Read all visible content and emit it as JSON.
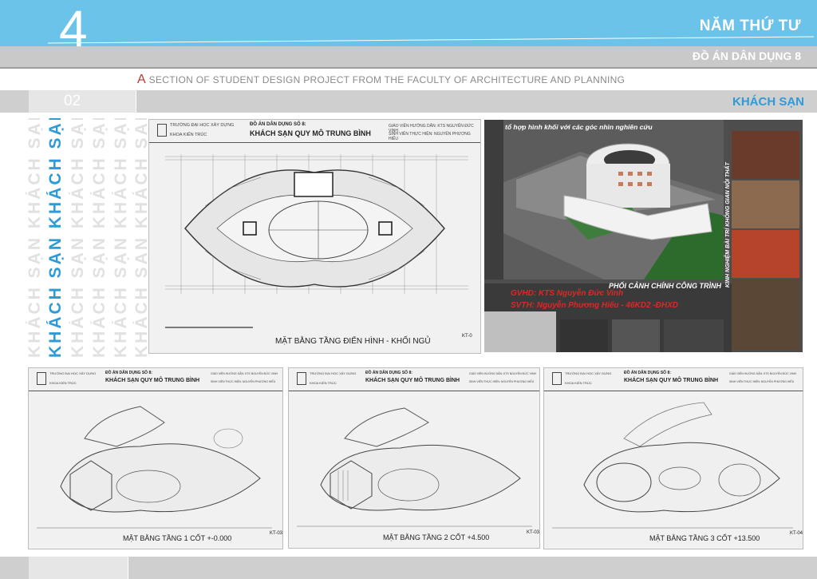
{
  "header": {
    "number": "4",
    "title": "NĂM THỨ TƯ",
    "subtitle": "ĐỒ ÁN DÂN DỤNG 8",
    "section_first_letter": "A",
    "section_rest": " SECTION OF STUDENT DESIGN PROJECT FROM THE FACULTY OF ARCHITECTURE AND PLANNING"
  },
  "band": {
    "page_number": "02",
    "section_name": "KHÁCH SẠN"
  },
  "side_text": "KHÁCH SẠN KHÁCH SẠN",
  "colors": {
    "header_blue": "#6cc3ea",
    "accent": "#2e9bd8",
    "band_grey": "#cfcfcf",
    "highlight_red": "#c0392b"
  },
  "main_sheet": {
    "school": "TRƯỜNG ĐẠI HỌC XÂY DỰNG",
    "department": "KHOA KIẾN TRÚC",
    "project": "ĐỒ ÁN DÂN DỤNG SỐ 8:",
    "name": "KHÁCH SẠN QUY MÔ TRUNG BÌNH",
    "tutor": "GIÁO VIÊN HƯỚNG DẪN: KTS NGUYỄN ĐỨC VINH",
    "student": "SINH VIÊN THỰC HIỆN: NGUYỄN PHƯƠNG HIẾU",
    "caption": "MẶT BẰNG TẦNG ĐIỂN HÌNH - KHỐI NGỦ",
    "code": "KT-0"
  },
  "render": {
    "title": "tổ hợp hình khối với các góc nhìn nghiên cứu",
    "perspective": "PHỐI CẢNH CHÍNH CÔNG TRÌNH",
    "gvhd": "GVHD: KTS Nguyễn Đức Vinh",
    "svth": "SVTH: Nguyễn Phương Hiếu - 46KD2 -ĐHXD",
    "side_label": "KINH NGHIỆM BÀI TRÍ KHÔNG GIAN NỘI THẤT"
  },
  "sheets": [
    {
      "school": "TRƯỜNG ĐẠI HỌC XÂY DỰNG",
      "department": "KHOA KIẾN TRÚC",
      "project": "ĐỒ ÁN DÂN DỤNG SỐ 8:",
      "name": "KHÁCH SẠN QUY MÔ TRUNG BÌNH",
      "tutor": "GIÁO VIÊN HƯỚNG DẪN: KTS NGUYỄN ĐỨC VINH",
      "student": "SINH VIÊN THỰC HIỆN: NGUYỄN PHƯƠNG HIẾU",
      "caption": "MẶT BẰNG TẦNG 1 CỐT +-0.000",
      "code": "KT-03"
    },
    {
      "school": "TRƯỜNG ĐẠI HỌC XÂY DỰNG",
      "department": "KHOA KIẾN TRÚC",
      "project": "ĐỒ ÁN DÂN DỤNG SỐ 8:",
      "name": "KHÁCH SẠN QUY MÔ TRUNG BÌNH",
      "tutor": "GIÁO VIÊN HƯỚNG DẪN: KTS NGUYỄN ĐỨC VINH",
      "student": "SINH VIÊN THỰC HIỆN: NGUYỄN PHƯƠNG HIẾU",
      "caption": "MẶT BẰNG TẦNG 2 CỐT +4.500",
      "code": "KT-03"
    },
    {
      "school": "TRƯỜNG ĐẠI HỌC XÂY DỰNG",
      "department": "KHOA KIẾN TRÚC",
      "project": "ĐỒ ÁN DÂN DỤNG SỐ 8:",
      "name": "KHÁCH SẠN QUY MÔ TRUNG BÌNH",
      "tutor": "GIÁO VIÊN HƯỚNG DẪN: KTS NGUYỄN ĐỨC VINH",
      "student": "SINH VIÊN THỰC HIỆN: NGUYỄN PHƯƠNG HIẾU",
      "caption": "MẶT BẰNG TẦNG 3 CỐT +13.500",
      "code": "KT-04"
    }
  ]
}
